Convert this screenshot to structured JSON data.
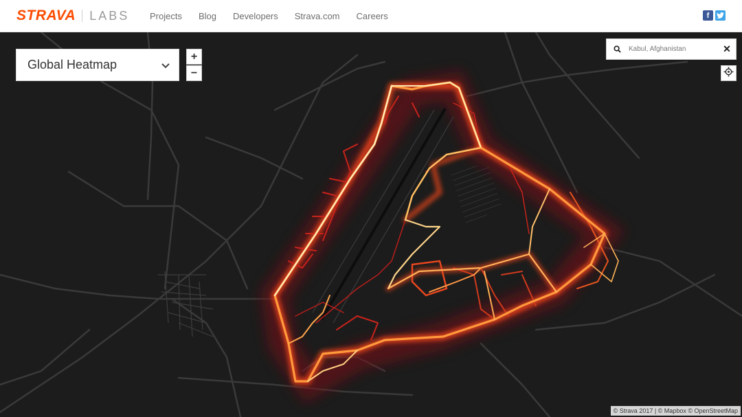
{
  "header": {
    "logo_brand": "STRAVA",
    "logo_sub": "LABS",
    "brand_color": "#fc4c02",
    "nav": [
      "Projects",
      "Blog",
      "Developers",
      "Strava.com",
      "Careers"
    ],
    "social": [
      "facebook-icon",
      "twitter-icon"
    ]
  },
  "map_controls": {
    "style_select": "Global Heatmap",
    "zoom_in": "+",
    "zoom_out": "−",
    "search_value": "Kabul, Afghanistan",
    "clear": "✕",
    "locate_icon": "crosshair-icon"
  },
  "map": {
    "background_color": "#1c1c1c",
    "road_color": "#3a3a3a",
    "heat_colors": [
      "#6e0f12",
      "#c8231b",
      "#ff7a2f",
      "#ffc865",
      "#fff4d0"
    ],
    "attribution": "© Strava 2017 | © Mapbox © OpenStreetMap"
  }
}
